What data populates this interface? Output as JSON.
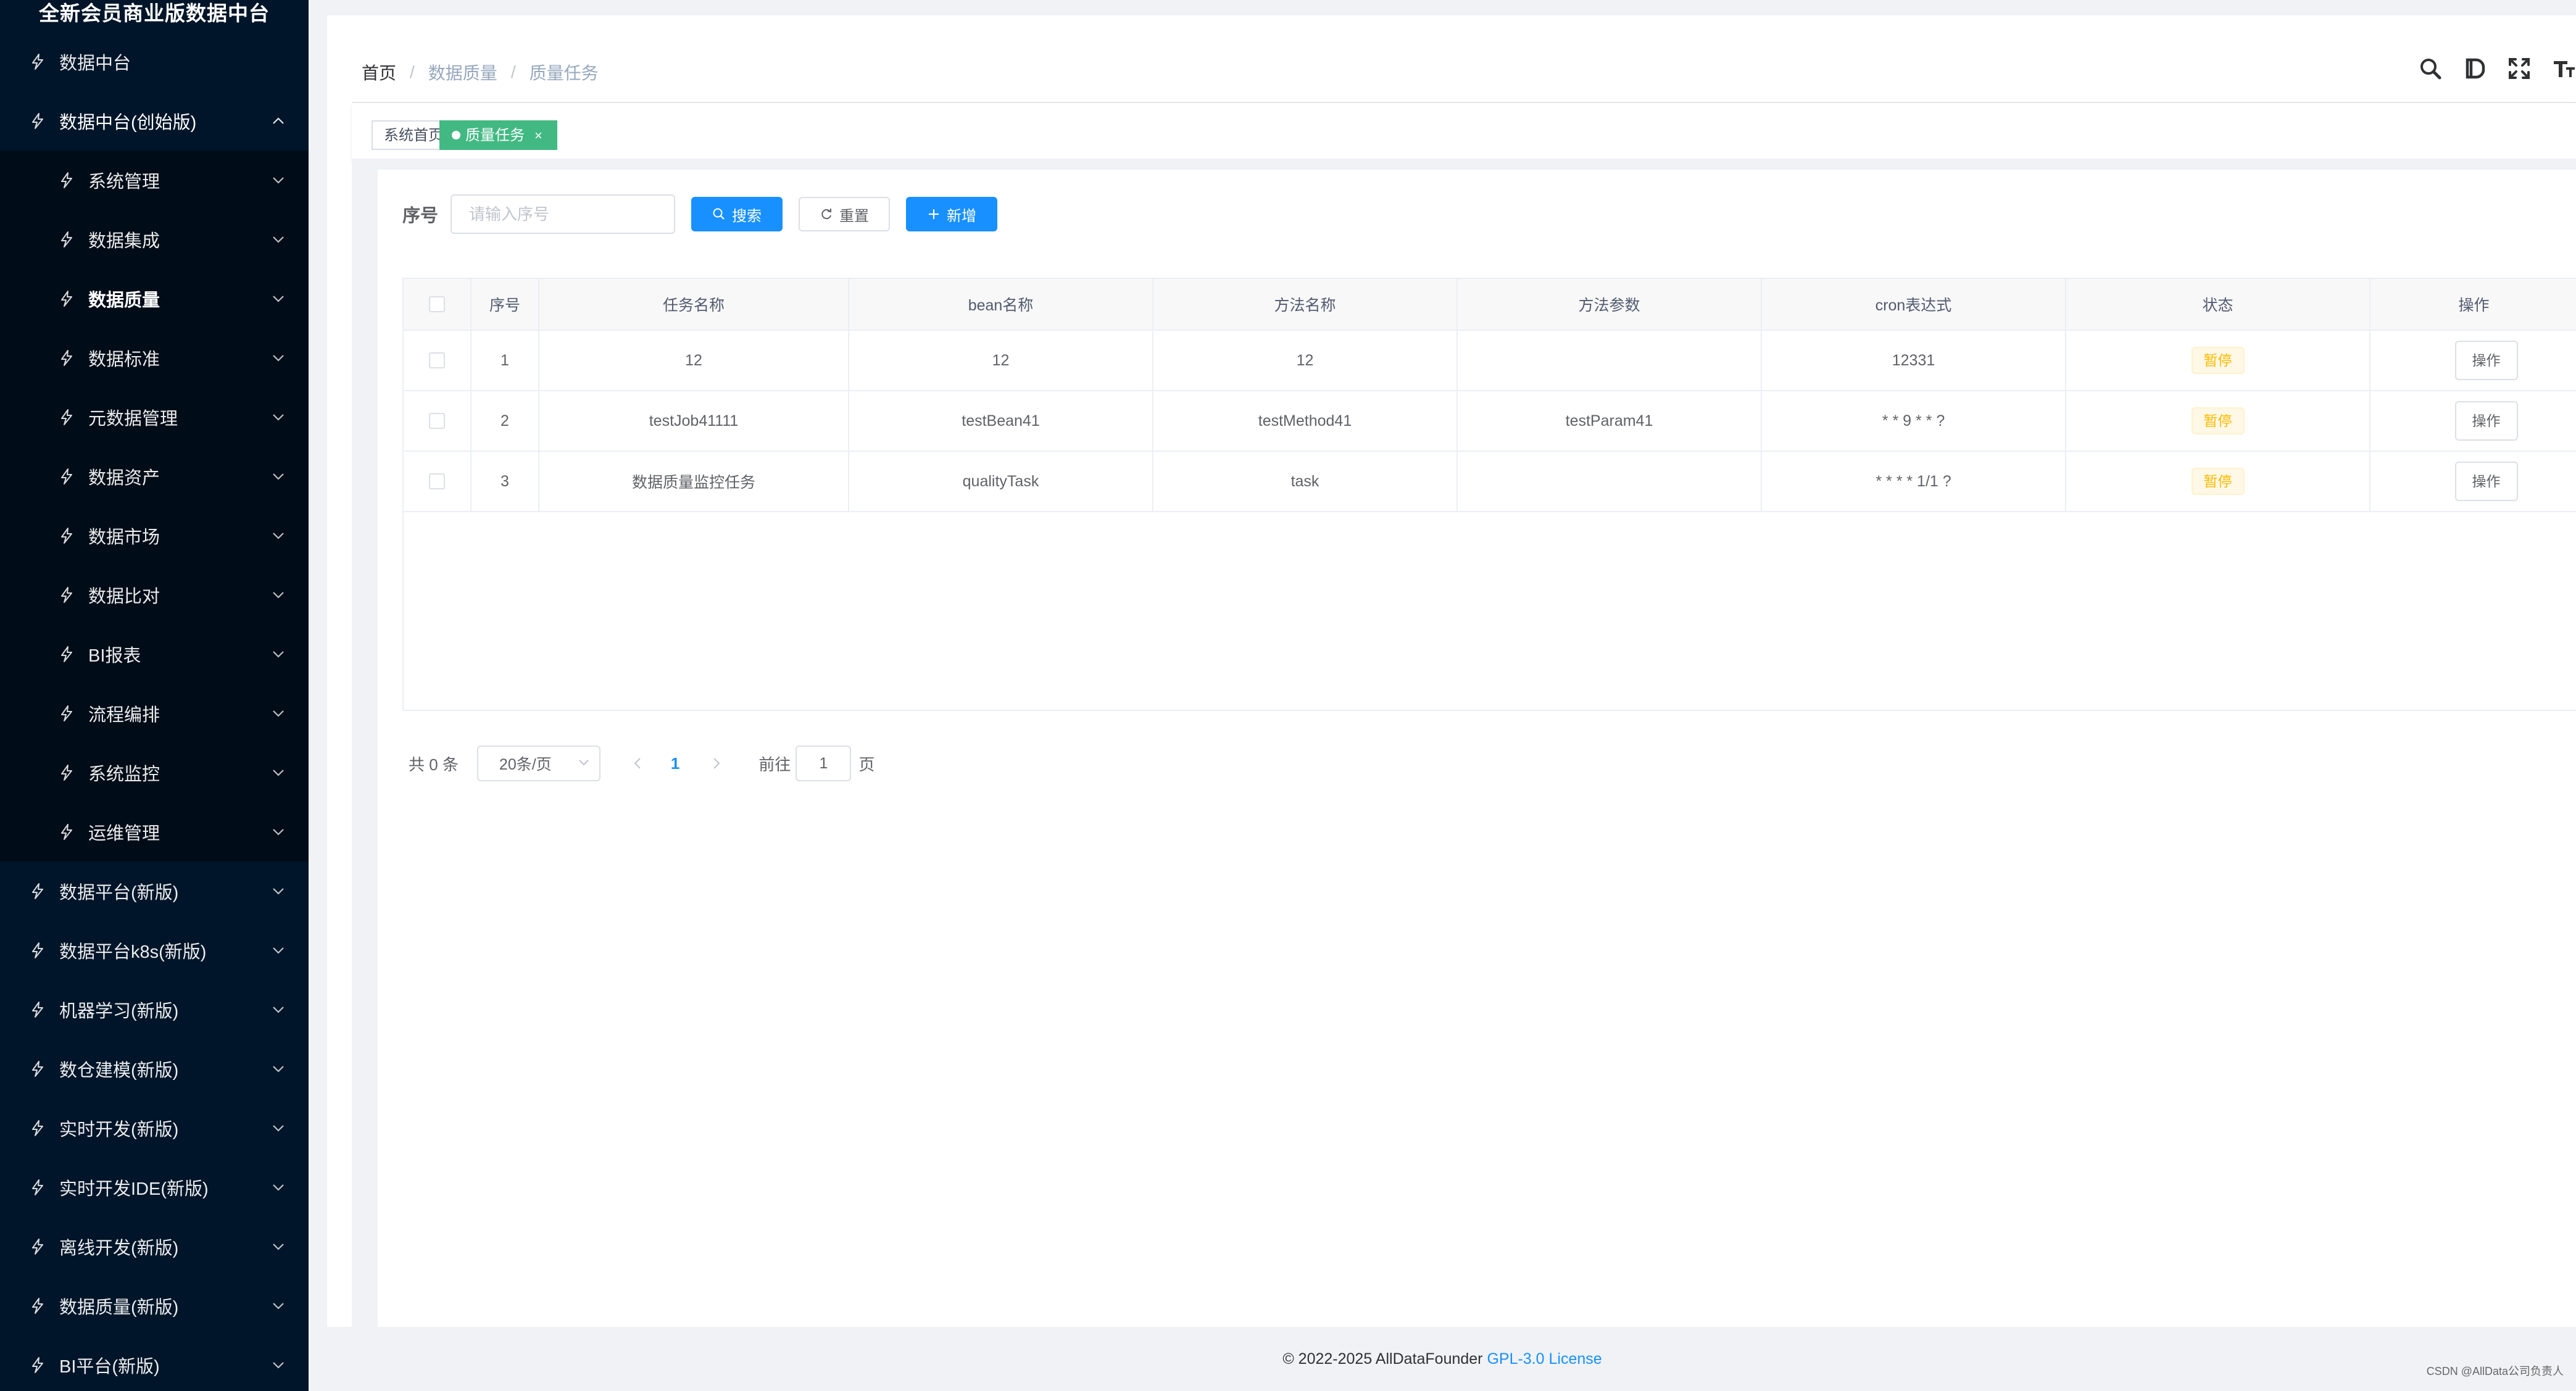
{
  "app": {
    "title": "全新会员商业版数据中台"
  },
  "sidebar": {
    "items": [
      {
        "label": "数据中台",
        "level": "top",
        "expandable": false
      },
      {
        "label": "数据中台(创始版)",
        "level": "top",
        "expandable": true,
        "expanded": true
      },
      {
        "label": "系统管理",
        "level": "sub",
        "expandable": true
      },
      {
        "label": "数据集成",
        "level": "sub",
        "expandable": true
      },
      {
        "label": "数据质量",
        "level": "sub",
        "expandable": true,
        "selected": true
      },
      {
        "label": "数据标准",
        "level": "sub",
        "expandable": true
      },
      {
        "label": "元数据管理",
        "level": "sub",
        "expandable": true
      },
      {
        "label": "数据资产",
        "level": "sub",
        "expandable": true
      },
      {
        "label": "数据市场",
        "level": "sub",
        "expandable": true
      },
      {
        "label": "数据比对",
        "level": "sub",
        "expandable": true
      },
      {
        "label": "BI报表",
        "level": "sub",
        "expandable": true
      },
      {
        "label": "流程编排",
        "level": "sub",
        "expandable": true
      },
      {
        "label": "系统监控",
        "level": "sub",
        "expandable": true
      },
      {
        "label": "运维管理",
        "level": "sub",
        "expandable": true
      },
      {
        "label": "数据平台(新版)",
        "level": "top",
        "expandable": true
      },
      {
        "label": "数据平台k8s(新版)",
        "level": "top",
        "expandable": true
      },
      {
        "label": "机器学习(新版)",
        "level": "top",
        "expandable": true
      },
      {
        "label": "数仓建模(新版)",
        "level": "top",
        "expandable": true
      },
      {
        "label": "实时开发(新版)",
        "level": "top",
        "expandable": true
      },
      {
        "label": "实时开发IDE(新版)",
        "level": "top",
        "expandable": true
      },
      {
        "label": "离线开发(新版)",
        "level": "top",
        "expandable": true
      },
      {
        "label": "数据质量(新版)",
        "level": "top",
        "expandable": true
      },
      {
        "label": "BI平台(新版)",
        "level": "top",
        "expandable": true
      }
    ]
  },
  "breadcrumb": [
    "首页",
    "数据质量",
    "质量任务"
  ],
  "navbar": {
    "icons": [
      "search-icon",
      "document-icon",
      "fullscreen-icon",
      "text-size-icon"
    ]
  },
  "tags": [
    {
      "label": "系统首页",
      "active": false
    },
    {
      "label": "质量任务",
      "active": true,
      "close": "×"
    }
  ],
  "search": {
    "label": "序号",
    "placeholder": "请输入序号",
    "search_btn": "搜索",
    "reset_btn": "重置",
    "add_btn": "新增"
  },
  "table": {
    "headers": [
      "序号",
      "任务名称",
      "bean名称",
      "方法名称",
      "方法参数",
      "cron表达式",
      "状态",
      "操作"
    ],
    "rows": [
      {
        "id": "1",
        "name": "12",
        "bean": "12",
        "method": "12",
        "params": "",
        "cron": "12331",
        "status": "暂停",
        "op": "操作"
      },
      {
        "id": "2",
        "name": "testJob41111",
        "bean": "testBean41",
        "method": "testMethod41",
        "params": "testParam41",
        "cron": "* * 9 * * ?",
        "status": "暂停",
        "op": "操作"
      },
      {
        "id": "3",
        "name": "数据质量监控任务",
        "bean": "qualityTask",
        "method": "task",
        "params": "",
        "cron": "* * * * 1/1 ?",
        "status": "暂停",
        "op": "操作"
      }
    ]
  },
  "pagination": {
    "total_text": "共 0 条",
    "page_size": "20条/页",
    "current": "1",
    "goto_label": "前往",
    "goto_value": "1",
    "page_suffix": "页"
  },
  "footer": {
    "copyright": "© 2022-2025 AllDataFounder ",
    "license": "GPL-3.0 License"
  },
  "watermark": "CSDN @AllData公司负责人",
  "colors": {
    "sidebar_bg": "#001529",
    "submenu_bg": "#000c17",
    "primary": "#1890ff",
    "active_tag": "#42b983",
    "warning": "#ffba00"
  }
}
